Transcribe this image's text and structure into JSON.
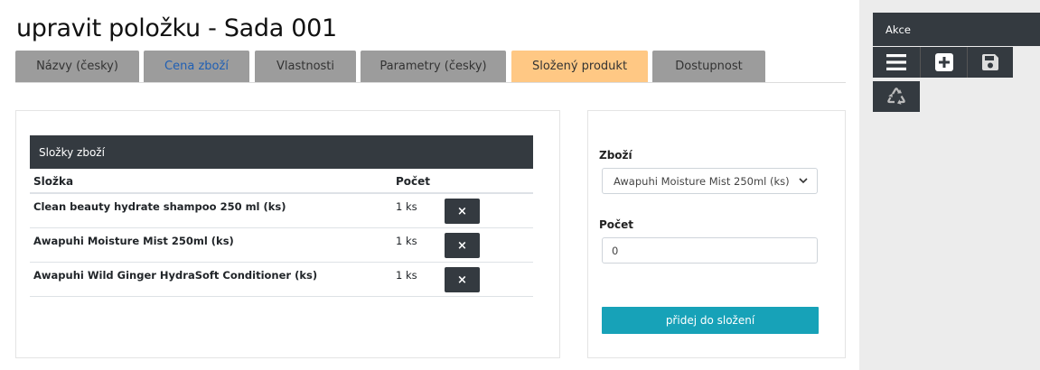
{
  "page": {
    "title": "upravit položku - Sada 001"
  },
  "tabs": [
    {
      "label": "Názvy (česky)"
    },
    {
      "label": "Cena zboží"
    },
    {
      "label": "Vlastnosti"
    },
    {
      "label": "Parametry (česky)"
    },
    {
      "label": "Složený produkt"
    },
    {
      "label": "Dostupnost"
    }
  ],
  "components": {
    "header": "Složky zboží",
    "columns": {
      "name": "Složka",
      "count": "Počet"
    },
    "rows": [
      {
        "name": "Clean beauty hydrate shampoo 250 ml (ks)",
        "count": "1 ks",
        "delete": "×"
      },
      {
        "name": "Awapuhi Moisture Mist 250ml (ks)",
        "count": "1 ks",
        "delete": "×"
      },
      {
        "name": "Awapuhi Wild Ginger HydraSoft Conditioner (ks)",
        "count": "1 ks",
        "delete": "×"
      }
    ]
  },
  "form": {
    "product_label": "Zboží",
    "product_value": "Awapuhi Moisture Mist 250ml (ks)",
    "count_label": "Počet",
    "count_value": "0",
    "submit_label": "přidej do složení"
  },
  "sidebar": {
    "header": "Akce",
    "buttons": [
      {
        "icon": "menu-icon"
      },
      {
        "icon": "plus-square-icon"
      },
      {
        "icon": "save-icon"
      },
      {
        "icon": "recycle-icon"
      }
    ]
  },
  "colors": {
    "dark": "#343a40",
    "tab_inactive": "#9c9c9c",
    "tab_active": "#ffc884",
    "link": "#1f5fb4",
    "accent": "#17a2b8"
  }
}
